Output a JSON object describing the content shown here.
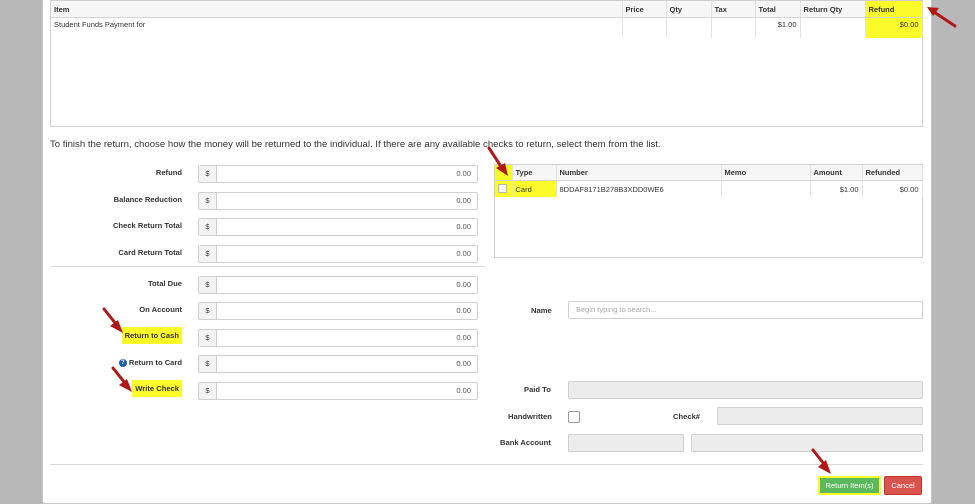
{
  "items_table": {
    "headers": [
      "Item",
      "Price",
      "Qty",
      "Tax",
      "Total",
      "Return Qty",
      "Refund"
    ],
    "rows": [
      {
        "item": "Student Funds Payment for",
        "price": "",
        "qty": "",
        "tax": "",
        "total": "$1.00",
        "return_qty": "",
        "refund": "$0.00"
      }
    ]
  },
  "instruction": "To finish the return, choose how the money will be returned to the individual. If there are any available checks to return, select them from the list.",
  "currency_symbol": "$",
  "form": {
    "refund": {
      "label": "Refund",
      "value": "0.00"
    },
    "balance_reduction": {
      "label": "Balance Reduction",
      "value": "0.00"
    },
    "check_return_total": {
      "label": "Check Return Total",
      "value": "0.00"
    },
    "card_return_total": {
      "label": "Card Return Total",
      "value": "0.00"
    },
    "total_due": {
      "label": "Total Due",
      "value": "0.00"
    },
    "on_account": {
      "label": "On Account",
      "value": "0.00"
    },
    "return_to_cash": {
      "label": "Return to Cash",
      "value": "0.00"
    },
    "return_to_card": {
      "label": "Return to Card",
      "value": "0.00"
    },
    "write_check": {
      "label": "Write Check",
      "value": "0.00"
    }
  },
  "checks_table": {
    "headers": [
      "Type",
      "Number",
      "Memo",
      "Amount",
      "Refunded"
    ],
    "rows": [
      {
        "type": "Card",
        "number": "8DDAF8171B278B3XDD0WE6",
        "memo": "",
        "amount": "$1.00",
        "refunded": "$0.00"
      }
    ]
  },
  "right_form": {
    "name_label": "Name",
    "name_placeholder": "Begin typing to search...",
    "paid_to_label": "Paid To",
    "handwritten_label": "Handwritten",
    "check_num_label": "Check#",
    "bank_account_label": "Bank Account"
  },
  "buttons": {
    "return_items": "Return Item(s)",
    "cancel": "Cancel"
  },
  "colors": {
    "highlight": "#fbfb2a",
    "arrow": "#b01818",
    "success": "#5cb85c",
    "danger": "#d9534f"
  }
}
